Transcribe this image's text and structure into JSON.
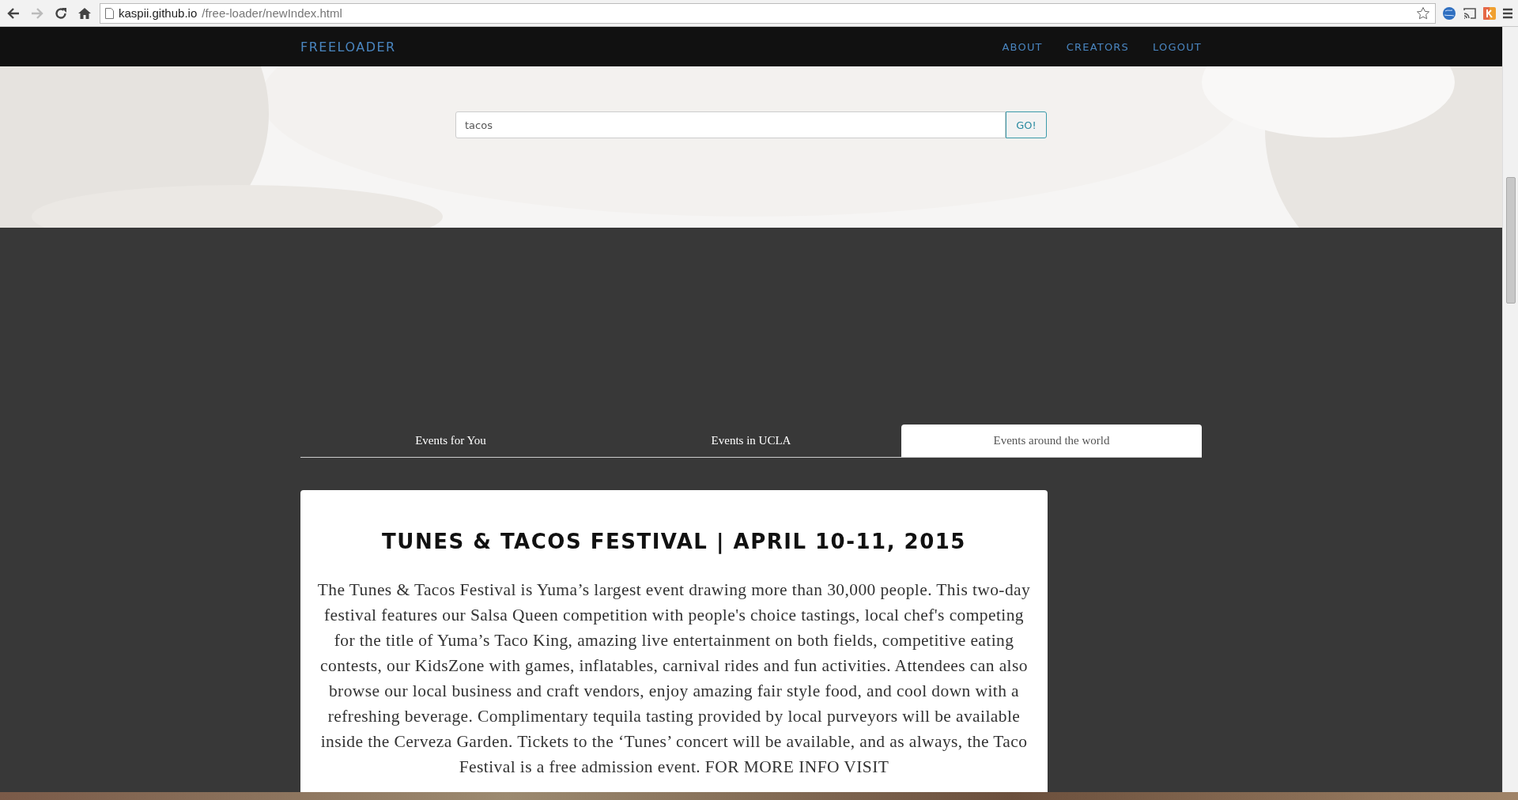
{
  "browser": {
    "url_host": "kaspii.github.io",
    "url_path": "/free-loader/newIndex.html",
    "forward_disabled": true
  },
  "navbar": {
    "brand": "FREELOADER",
    "links": [
      "ABOUT",
      "CREATORS",
      "LOGOUT"
    ]
  },
  "search": {
    "value": "tacos",
    "button": "GO!"
  },
  "tabs": [
    {
      "label": "Events for You",
      "selected": false
    },
    {
      "label": "Events in UCLA",
      "selected": false
    },
    {
      "label": "Events around the world",
      "selected": true
    }
  ],
  "event": {
    "title": "TUNES & TACOS FESTIVAL | APRIL 10-11, 2015",
    "description": "The Tunes & Tacos Festival is Yuma’s largest event drawing more than 30,000 people. This two-day festival features our Salsa Queen competition with people's choice tastings, local chef's competing for the title of Yuma’s Taco King, amazing live entertainment on both fields, competitive eating contests, our KidsZone with games, inflatables, carnival rides and fun activities. Attendees can also browse our local business and craft vendors, enjoy amazing fair style food, and cool down with a refreshing beverage. Complimentary tequila tasting provided by local purveyors will be available inside the Cerveza Garden. Tickets to the ‘Tunes’ concert will be available, and as always, the Taco Festival is a free admission event. FOR MORE INFO VISIT"
  }
}
